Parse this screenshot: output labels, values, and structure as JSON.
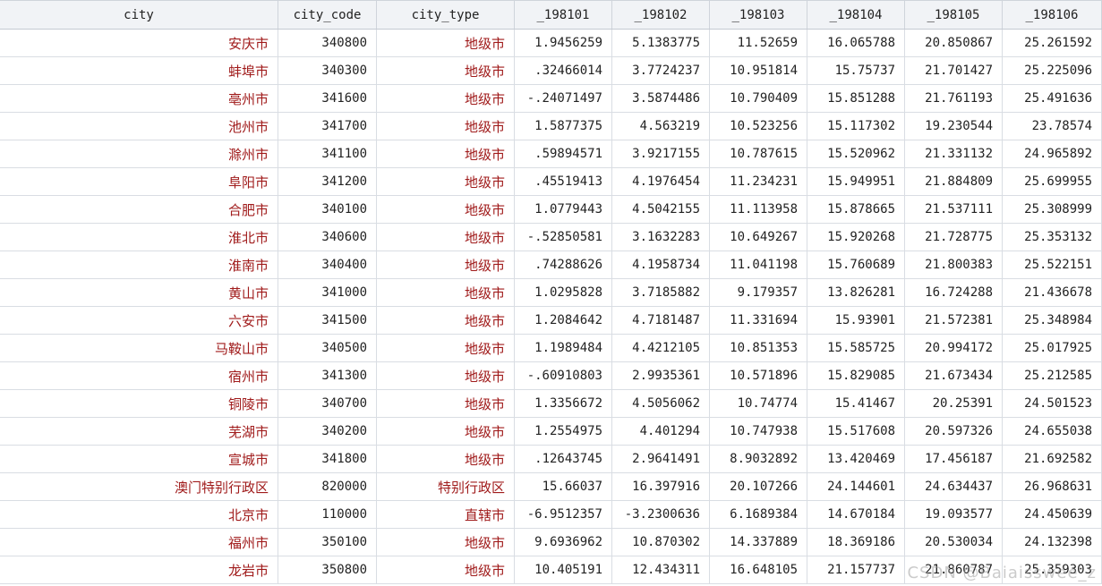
{
  "columns": [
    "city",
    "city_code",
    "city_type",
    "_198101",
    "_198102",
    "_198103",
    "_198104",
    "_198105",
    "_198106"
  ],
  "rows": [
    [
      "安庆市",
      "340800",
      "地级市",
      "1.9456259",
      "5.1383775",
      "11.52659",
      "16.065788",
      "20.850867",
      "25.261592"
    ],
    [
      "蚌埠市",
      "340300",
      "地级市",
      ".32466014",
      "3.7724237",
      "10.951814",
      "15.75737",
      "21.701427",
      "25.225096"
    ],
    [
      "亳州市",
      "341600",
      "地级市",
      "-.24071497",
      "3.5874486",
      "10.790409",
      "15.851288",
      "21.761193",
      "25.491636"
    ],
    [
      "池州市",
      "341700",
      "地级市",
      "1.5877375",
      "4.563219",
      "10.523256",
      "15.117302",
      "19.230544",
      "23.78574"
    ],
    [
      "滁州市",
      "341100",
      "地级市",
      ".59894571",
      "3.9217155",
      "10.787615",
      "15.520962",
      "21.331132",
      "24.965892"
    ],
    [
      "阜阳市",
      "341200",
      "地级市",
      ".45519413",
      "4.1976454",
      "11.234231",
      "15.949951",
      "21.884809",
      "25.699955"
    ],
    [
      "合肥市",
      "340100",
      "地级市",
      "1.0779443",
      "4.5042155",
      "11.113958",
      "15.878665",
      "21.537111",
      "25.308999"
    ],
    [
      "淮北市",
      "340600",
      "地级市",
      "-.52850581",
      "3.1632283",
      "10.649267",
      "15.920268",
      "21.728775",
      "25.353132"
    ],
    [
      "淮南市",
      "340400",
      "地级市",
      ".74288626",
      "4.1958734",
      "11.041198",
      "15.760689",
      "21.800383",
      "25.522151"
    ],
    [
      "黄山市",
      "341000",
      "地级市",
      "1.0295828",
      "3.7185882",
      "9.179357",
      "13.826281",
      "16.724288",
      "21.436678"
    ],
    [
      "六安市",
      "341500",
      "地级市",
      "1.2084642",
      "4.7181487",
      "11.331694",
      "15.93901",
      "21.572381",
      "25.348984"
    ],
    [
      "马鞍山市",
      "340500",
      "地级市",
      "1.1989484",
      "4.4212105",
      "10.851353",
      "15.585725",
      "20.994172",
      "25.017925"
    ],
    [
      "宿州市",
      "341300",
      "地级市",
      "-.60910803",
      "2.9935361",
      "10.571896",
      "15.829085",
      "21.673434",
      "25.212585"
    ],
    [
      "铜陵市",
      "340700",
      "地级市",
      "1.3356672",
      "4.5056062",
      "10.74774",
      "15.41467",
      "20.25391",
      "24.501523"
    ],
    [
      "芜湖市",
      "340200",
      "地级市",
      "1.2554975",
      "4.401294",
      "10.747938",
      "15.517608",
      "20.597326",
      "24.655038"
    ],
    [
      "宣城市",
      "341800",
      "地级市",
      ".12643745",
      "2.9641491",
      "8.9032892",
      "13.420469",
      "17.456187",
      "21.692582"
    ],
    [
      "澳门特别行政区",
      "820000",
      "特别行政区",
      "15.66037",
      "16.397916",
      "20.107266",
      "24.144601",
      "24.634437",
      "26.968631"
    ],
    [
      "北京市",
      "110000",
      "直辖市",
      "-6.9512357",
      "-3.2300636",
      "6.1689384",
      "14.670184",
      "19.093577",
      "24.450639"
    ],
    [
      "福州市",
      "350100",
      "地级市",
      "9.6936962",
      "10.870302",
      "14.337889",
      "18.369186",
      "20.530034",
      "24.132398"
    ],
    [
      "龙岩市",
      "350800",
      "地级市",
      "10.405191",
      "12.434311",
      "16.648105",
      "21.157737",
      "21.860787",
      "25.359303"
    ]
  ],
  "watermark": "CSDN @Baiaisswee_z"
}
